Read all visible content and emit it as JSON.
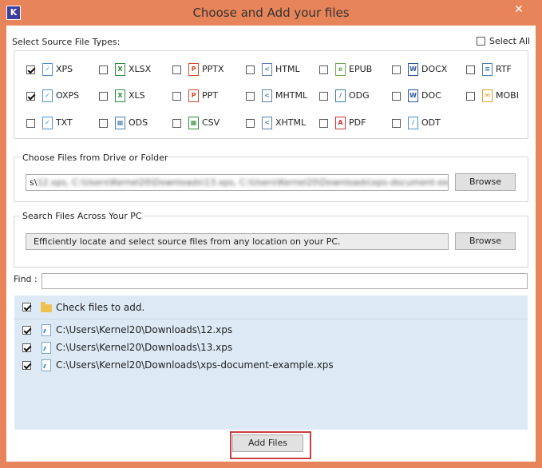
{
  "window": {
    "title": "Choose and Add your files",
    "icon_letter": "K",
    "close_glyph": "✕"
  },
  "source_types": {
    "label": "Select Source File Types:",
    "select_all_label": "Select All",
    "types": [
      {
        "label": "XPS",
        "checked": true,
        "icon": "xps-icon",
        "color": "#4a90d0",
        "glyph": "✓"
      },
      {
        "label": "XLSX",
        "checked": false,
        "icon": "xlsx-icon",
        "color": "#2e8b3e",
        "glyph": "X"
      },
      {
        "label": "PPTX",
        "checked": false,
        "icon": "pptx-icon",
        "color": "#d04a2a",
        "glyph": "P"
      },
      {
        "label": "HTML",
        "checked": false,
        "icon": "html-icon",
        "color": "#5a7fb0",
        "glyph": "&lt;"
      },
      {
        "label": "EPUB",
        "checked": false,
        "icon": "epub-icon",
        "color": "#6aa84f",
        "glyph": "e"
      },
      {
        "label": "DOCX",
        "checked": false,
        "icon": "docx-icon",
        "color": "#2b579a",
        "glyph": "W"
      },
      {
        "label": "RTF",
        "checked": false,
        "icon": "rtf-icon",
        "color": "#4a7fb0",
        "glyph": "≡"
      },
      {
        "label": "OXPS",
        "checked": true,
        "icon": "oxps-icon",
        "color": "#4a90d0",
        "glyph": "✓"
      },
      {
        "label": "XLS",
        "checked": false,
        "icon": "xls-icon",
        "color": "#2e8b3e",
        "glyph": "X"
      },
      {
        "label": "PPT",
        "checked": false,
        "icon": "ppt-icon",
        "color": "#d04a2a",
        "glyph": "P"
      },
      {
        "label": "MHTML",
        "checked": false,
        "icon": "mhtml-icon",
        "color": "#5a7fb0",
        "glyph": "&lt;"
      },
      {
        "label": "ODG",
        "checked": false,
        "icon": "odg-icon",
        "color": "#3a7f9f",
        "glyph": "/"
      },
      {
        "label": "DOC",
        "checked": false,
        "icon": "doc-icon",
        "color": "#2b579a",
        "glyph": "W"
      },
      {
        "label": "MOBI",
        "checked": false,
        "icon": "mobi-icon",
        "color": "#e0a030",
        "glyph": "✉"
      },
      {
        "label": "TXT",
        "checked": false,
        "icon": "txt-icon",
        "color": "#4a90d0",
        "glyph": "✓"
      },
      {
        "label": "ODS",
        "checked": false,
        "icon": "ods-icon",
        "color": "#4a7fb0",
        "glyph": "▦"
      },
      {
        "label": "CSV",
        "checked": false,
        "icon": "csv-icon",
        "color": "#2e8b3e",
        "glyph": "▦"
      },
      {
        "label": "XHTML",
        "checked": false,
        "icon": "xhtml-icon",
        "color": "#5a7fb0",
        "glyph": "&lt;"
      },
      {
        "label": "PDF",
        "checked": false,
        "icon": "pdf-icon",
        "color": "#d03030",
        "glyph": "A"
      },
      {
        "label": "ODT",
        "checked": false,
        "icon": "odt-icon",
        "color": "#4a90d0",
        "glyph": "/"
      }
    ]
  },
  "choose_files": {
    "label": "Choose Files from Drive or Folder",
    "path_start": "s\\",
    "path_blurred": "12.xps, C:\\Users\\Kernel20\\Downloads\\13.xps, C:\\Users\\Kernel20\\Downloads\\xps-document-example.xps",
    "path_end": "]",
    "browse_label": "Browse"
  },
  "search_files": {
    "label": "Search Files Across Your PC",
    "description": "Efficiently locate and select source files from any location on your PC.",
    "browse_label": "Browse"
  },
  "find": {
    "label": "Find :",
    "value": ""
  },
  "file_list": {
    "header": "Check files to add.",
    "header_checked": true,
    "files": [
      {
        "path": "C:\\Users\\Kernel20\\Downloads\\12.xps",
        "checked": true
      },
      {
        "path": "C:\\Users\\Kernel20\\Downloads\\13.xps",
        "checked": true
      },
      {
        "path": "C:\\Users\\Kernel20\\Downloads\\xps-document-example.xps",
        "checked": true
      }
    ]
  },
  "actions": {
    "add_files_label": "Add Files"
  }
}
